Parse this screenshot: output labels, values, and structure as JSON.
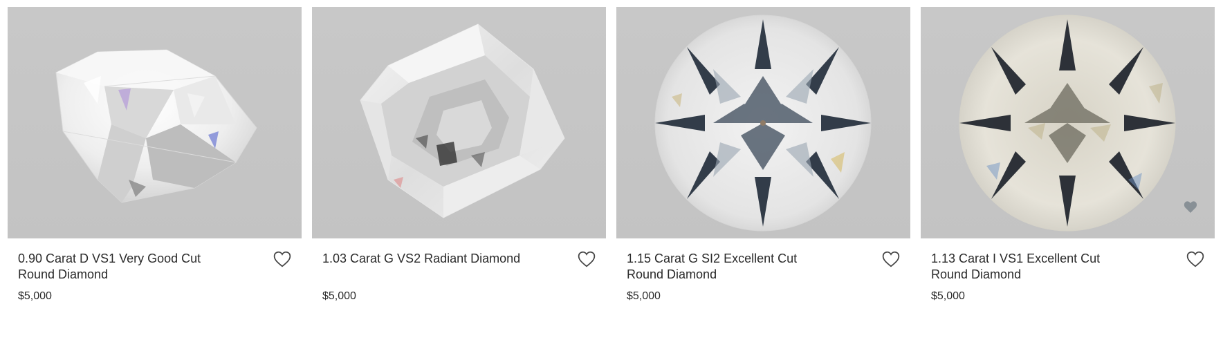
{
  "products": [
    {
      "title": "0.90 Carat D VS1 Very Good Cut Round Diamond",
      "price": "$5,000",
      "shape": "round-side-view",
      "image_alt": "0.90 carat round diamond"
    },
    {
      "title": "1.03 Carat G VS2 Radiant Diamond",
      "price": "$5,000",
      "shape": "radiant",
      "image_alt": "1.03 carat radiant diamond"
    },
    {
      "title": "1.15 Carat G SI2 Excellent Cut Round Diamond",
      "price": "$5,000",
      "shape": "round-top-view",
      "image_alt": "1.15 carat round diamond"
    },
    {
      "title": "1.13 Carat I VS1 Excellent Cut Round Diamond",
      "price": "$5,000",
      "shape": "round-top-view",
      "image_alt": "1.13 carat round diamond"
    }
  ],
  "icons": {
    "favorite": "heart-outline-icon"
  },
  "colors": {
    "image_background": "#c6c6c6",
    "text": "#2a2a2a"
  }
}
